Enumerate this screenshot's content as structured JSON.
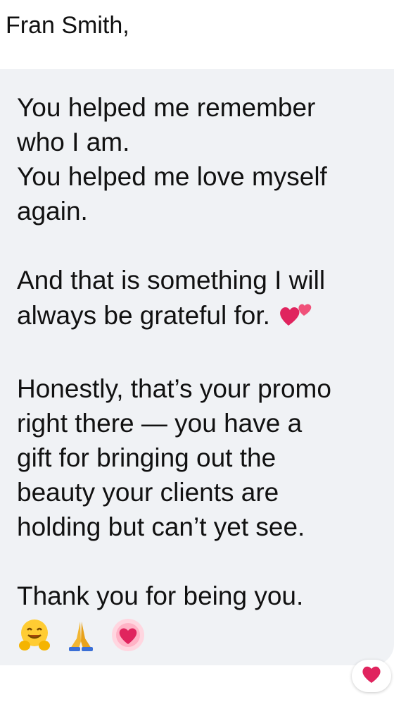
{
  "header": {
    "recipient": "Fran Smith,"
  },
  "message": {
    "paragraphs": [
      [
        "You helped me remember",
        "who I am.",
        "You helped me love myself",
        "again."
      ],
      [
        "And that is something I will",
        "always be grateful for."
      ],
      [
        "Honestly, that’s your promo",
        "right there — you have a",
        "gift for bringing out the",
        "beauty your clients are",
        "holding but can’t yet see."
      ],
      [
        "Thank you for being you."
      ]
    ],
    "inline_emoji": "two-hearts-icon",
    "trailing_emojis": [
      "hugging-face-icon",
      "folded-hands-icon",
      "growing-heart-icon"
    ]
  },
  "reaction": {
    "icon": "red-heart-icon",
    "color": "#e0245e"
  },
  "colors": {
    "bubble": "#f0f2f5",
    "text": "#111111",
    "heart": "#e0245e"
  }
}
